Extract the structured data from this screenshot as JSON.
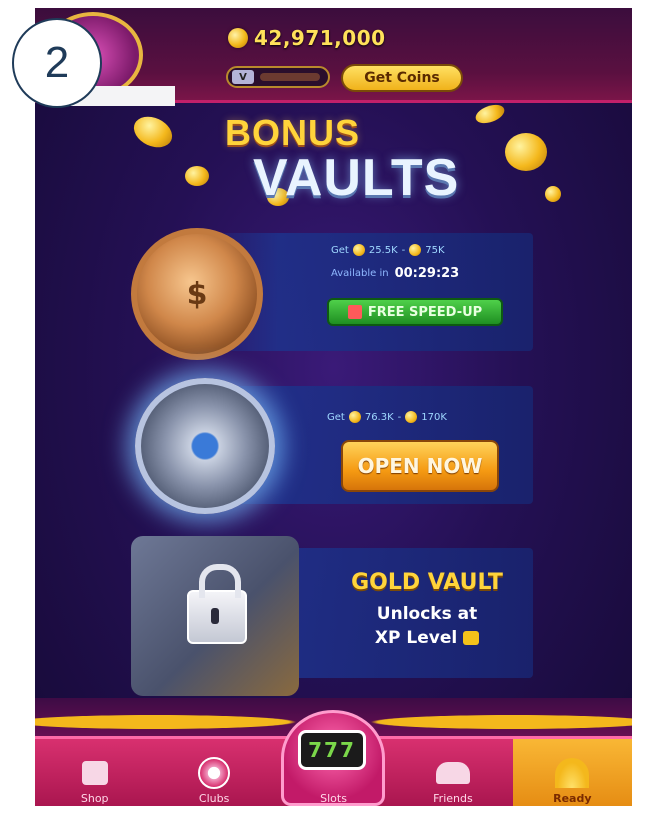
{
  "header": {
    "step_number": "2",
    "balance": "42,971,000",
    "vip_badge": "V",
    "get_coins_label": "Get Coins"
  },
  "title": {
    "line1": "BONUS",
    "line2": "VAULTS"
  },
  "vaults": [
    {
      "id": "bronze",
      "rewards_prefix": "Get",
      "reward_min": "25.5K",
      "reward_sep": "-",
      "reward_max": "75K",
      "timer_label": "Available in",
      "timer_value": "00:29:23",
      "action_label": "FREE SPEED-UP"
    },
    {
      "id": "silver",
      "rewards_prefix": "Get",
      "reward_min": "76.3K",
      "reward_sep": "-",
      "reward_max": "170K",
      "action_label": "OPEN NOW"
    },
    {
      "id": "gold",
      "title": "GOLD VAULT",
      "sub1": "Unlocks at",
      "sub2": "XP Level"
    }
  ],
  "nav": {
    "items": [
      {
        "label": "Shop",
        "icon": "shop-bag-icon"
      },
      {
        "label": "Clubs",
        "icon": "clubs-icon"
      },
      {
        "label": "Slots",
        "icon": "slot-machine-icon"
      },
      {
        "label": "Friends",
        "icon": "friends-icon"
      },
      {
        "label": "Ready",
        "icon": "bonus-ready-icon"
      }
    ],
    "slots_reels": "777",
    "active_color": "#f9b735"
  },
  "colors": {
    "background": "#241054",
    "header": "#5a1040",
    "accent_gold": "#ffd43b",
    "nav_pink": "#d8306f",
    "button_green": "#1f8f22",
    "button_orange": "#f59a12"
  }
}
